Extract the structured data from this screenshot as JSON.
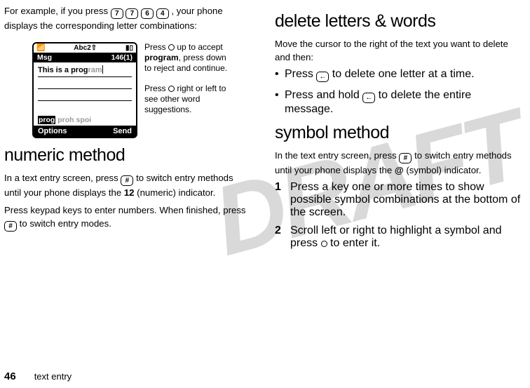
{
  "left": {
    "intro_pre": "For example, if you press ",
    "keys": [
      "7",
      "7",
      "6",
      "4"
    ],
    "intro_post": ", your phone displays the corresponding letter combinations:",
    "phone": {
      "status_center": "Abc2⇧",
      "bar_left": "Msg",
      "bar_right": "146(1)",
      "typed_prefix": "This is a prog",
      "typed_suggest": "ram",
      "sugg_selected": "prog",
      "sugg_rest": "proh spoi",
      "soft_left": "Options",
      "soft_right": "Send"
    },
    "annot1_l1": "Press ",
    "annot1_rest": " up to accept ",
    "annot1_bold": "program",
    "annot1_tail": ", press down to reject and continue.",
    "annot2_l1": "Press ",
    "annot2_rest": " right or left to see other word suggestions.",
    "h_numeric": "numeric method",
    "numeric_p1_a": "In a text entry screen, press ",
    "hash": "#",
    "numeric_p1_b": " to switch entry methods until your phone displays the ",
    "numeric_indicator": "12",
    "numeric_p1_c": " (numeric) indicator.",
    "numeric_p2_a": "Press keypad keys to enter numbers. When finished, press ",
    "numeric_p2_b": " to switch entry modes."
  },
  "right": {
    "h_delete": "delete letters & words",
    "del_intro": "Move the cursor to the right of the text you want to delete and then:",
    "b1_a": "Press ",
    "b1_b": " to delete one letter at a time.",
    "b2_a": "Press and hold ",
    "b2_b": " to delete the entire message.",
    "h_symbol": "symbol method",
    "sym_p_a": "In the text entry screen, press ",
    "sym_p_b": " to switch entry methods until your phone displays the ",
    "sym_indicator": "@",
    "sym_p_c": "(symbol) indicator.",
    "step1_n": "1",
    "step1_t": "Press a key one or more times to show possible symbol combinations at the bottom of the screen.",
    "step2_n": "2",
    "step2_a": "Scroll left or right to highlight a symbol and press ",
    "step2_b": " to enter it."
  },
  "footer": {
    "pagenum": "46",
    "section": "text entry"
  },
  "watermark": "DRAFT",
  "icons": {
    "back": "←"
  }
}
